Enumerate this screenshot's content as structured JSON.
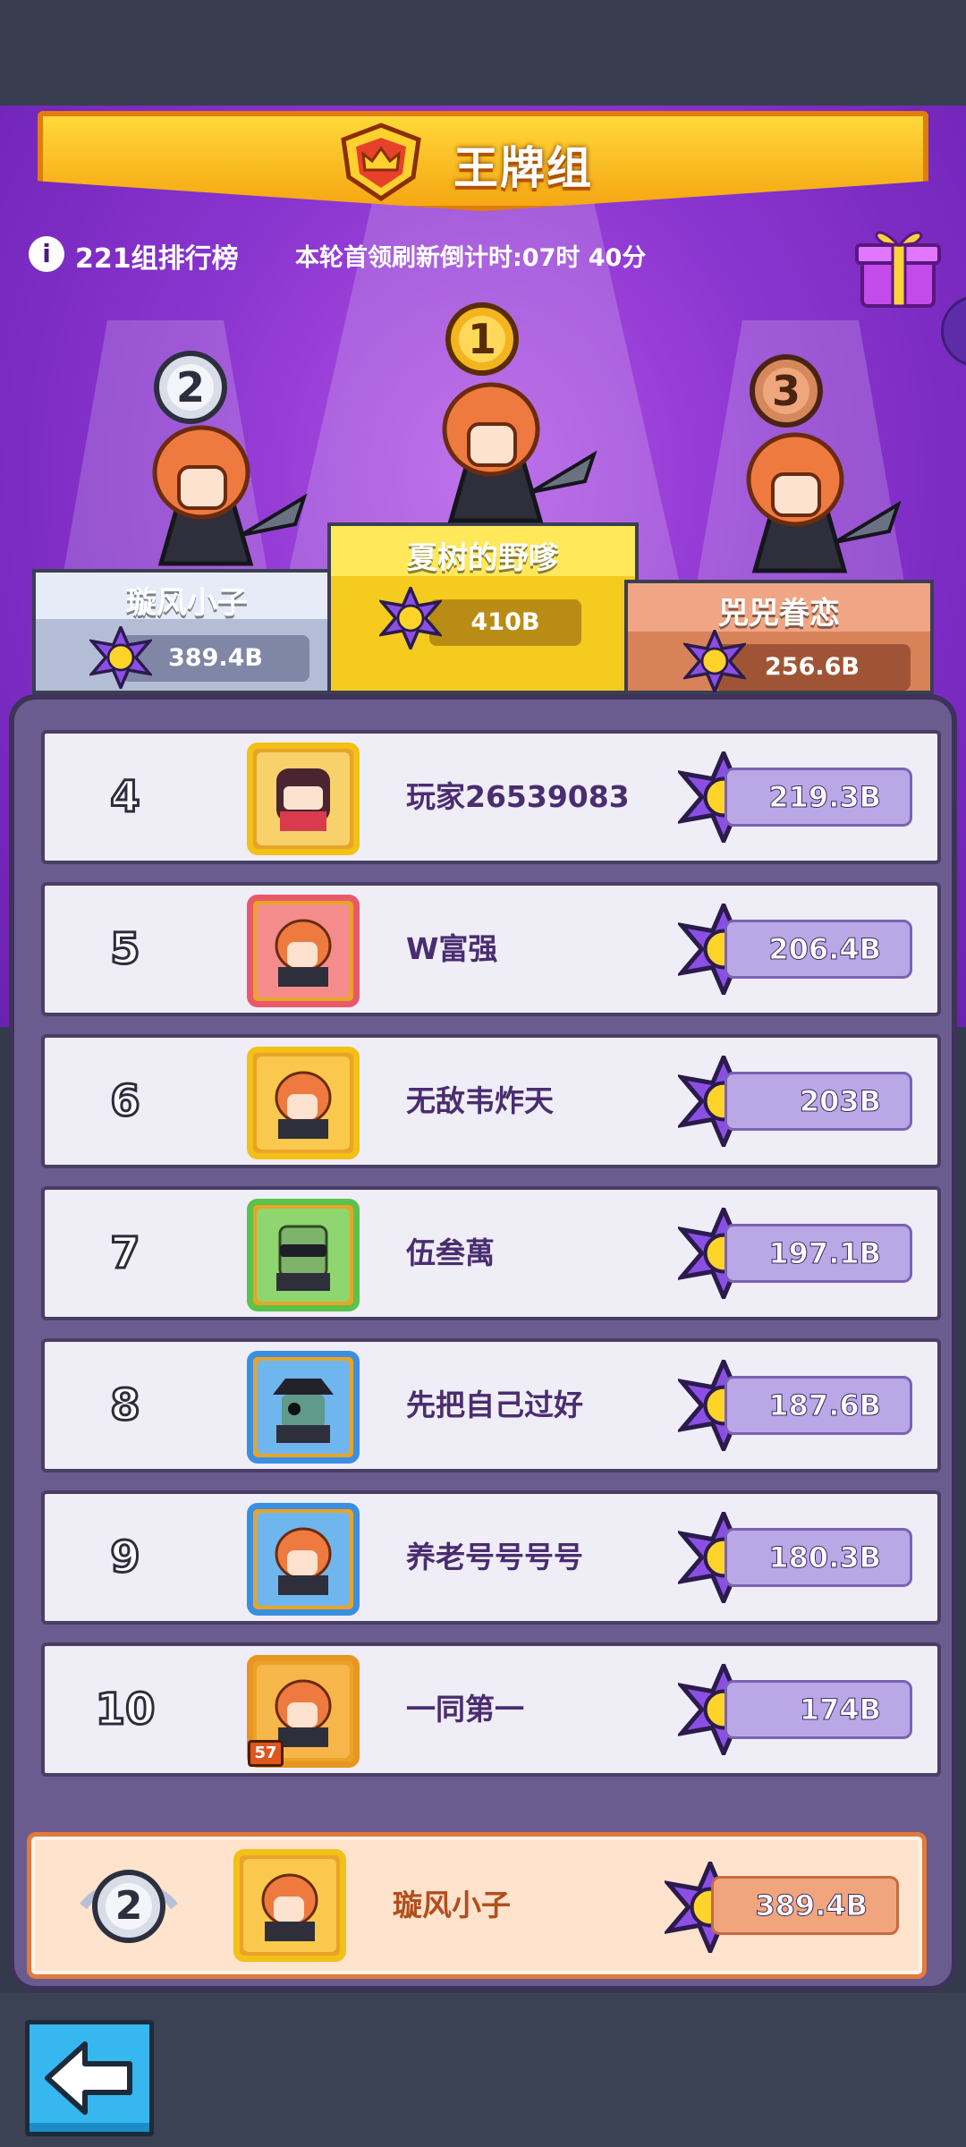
{
  "header": {
    "title": "王牌组",
    "group_rank_label": "221组排行榜",
    "refresh_text": "本轮首领刷新倒计时:07时 40分",
    "info_icon": "i"
  },
  "podium": [
    {
      "rank": "1",
      "name": "夏树的野嗲",
      "score": "410B"
    },
    {
      "rank": "2",
      "name": "璇风小子",
      "score": "389.4B"
    },
    {
      "rank": "3",
      "name": "兕兕眷恋",
      "score": "256.6B"
    }
  ],
  "rows": [
    {
      "rank": "4",
      "name": "玩家26539083",
      "score": "219.3B",
      "avatar": "ninja-girl-avatar"
    },
    {
      "rank": "5",
      "name": "W富强",
      "score": "206.4B",
      "avatar": "redhead-avatar"
    },
    {
      "rank": "6",
      "name": "无敌韦炸天",
      "score": "203B",
      "avatar": "redhead-avatar"
    },
    {
      "rank": "7",
      "name": "伍叁萬",
      "score": "197.1B",
      "avatar": "zombie-sunglasses-avatar"
    },
    {
      "rank": "8",
      "name": "先把自己过好",
      "score": "187.6B",
      "avatar": "pirate-zombie-avatar"
    },
    {
      "rank": "9",
      "name": "养老号号号号",
      "score": "180.3B",
      "avatar": "redhead-avatar"
    },
    {
      "rank": "10",
      "name": "一同第一",
      "score": "174B",
      "avatar": "redhead-avatar"
    }
  ],
  "avatar_level_badge": "57",
  "my_row": {
    "rank": "2",
    "name": "璇风小子",
    "score": "389.4B"
  },
  "colors": {
    "purple_bg": "#8a34cf",
    "banner_gold": "#f5a712",
    "row_bg": "#efedf6",
    "score_purple": "#b9a7e6",
    "mine_bg": "#ffe3cc",
    "back_blue": "#36b7f0"
  },
  "icons": [
    "info-icon",
    "crown-badge-icon",
    "gift-box-icon",
    "score-star-icon",
    "back-arrow-icon",
    "rank-medal-icon"
  ]
}
